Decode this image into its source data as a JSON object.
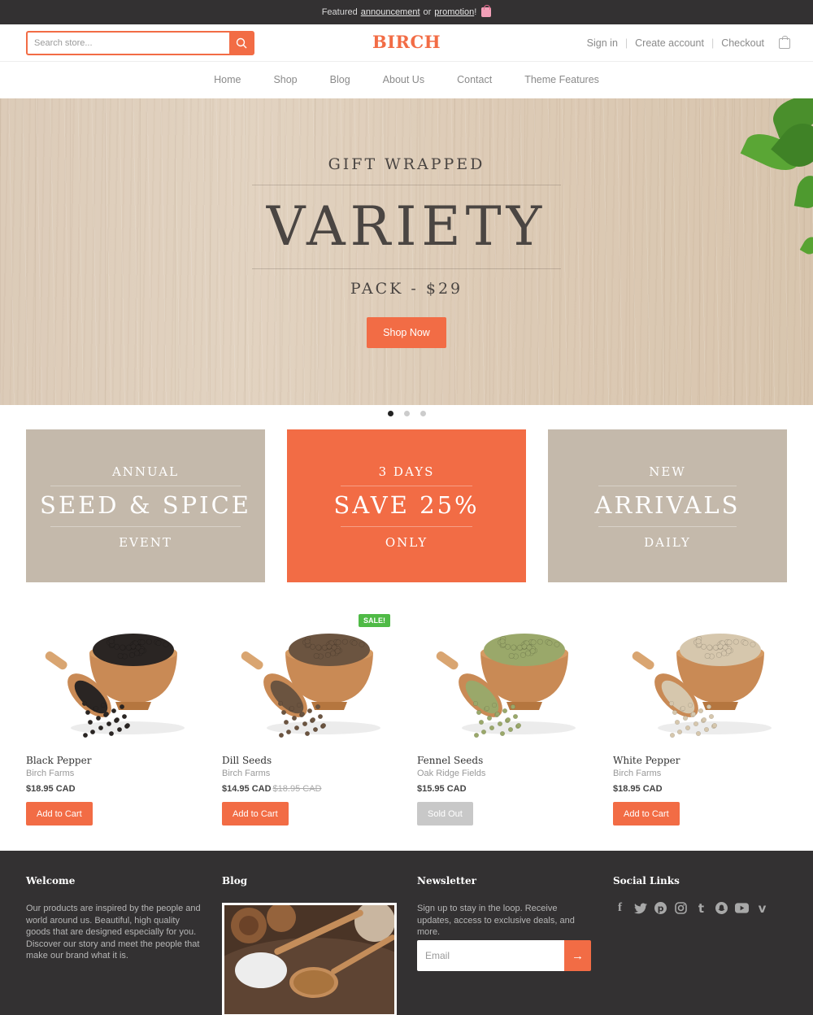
{
  "announcement": {
    "prefix": "Featured",
    "link1": "announcement",
    "middle": "or",
    "link2": "promotion",
    "suffix": "!"
  },
  "header": {
    "search_placeholder": "Search store...",
    "logo": "BIRCH",
    "account_links": [
      "Sign in",
      "Create account",
      "Checkout"
    ],
    "cart_icon": "shopping-bag-icon"
  },
  "nav": {
    "items": [
      "Home",
      "Shop",
      "Blog",
      "About Us",
      "Contact",
      "Theme Features"
    ]
  },
  "hero": {
    "kicker": "GIFT WRAPPED",
    "title": "VARIETY",
    "subtitle": "PACK - $29",
    "button": "Shop Now",
    "slides": 3,
    "active_slide": 1
  },
  "promos": [
    {
      "top": "ANNUAL",
      "main": "SEED & SPICE",
      "bottom": "EVENT",
      "color": "#c4b9ab"
    },
    {
      "top": "3 DAYS",
      "main": "SAVE 25%",
      "bottom": "ONLY",
      "color": "#f26c45"
    },
    {
      "top": "NEW",
      "main": "ARRIVALS",
      "bottom": "DAILY",
      "color": "#c4b9ab"
    }
  ],
  "products": [
    {
      "name": "Black Pepper",
      "vendor": "Birch Farms",
      "price": "$18.95 CAD",
      "old_price": "",
      "badge": "",
      "button": "Add to Cart",
      "seed_color": "#2a2523"
    },
    {
      "name": "Dill Seeds",
      "vendor": "Birch Farms",
      "price": "$14.95 CAD",
      "old_price": "$18.95 CAD",
      "badge": "SALE!",
      "button": "Add to Cart",
      "seed_color": "#6b5440"
    },
    {
      "name": "Fennel Seeds",
      "vendor": "Oak Ridge Fields",
      "price": "$15.95 CAD",
      "old_price": "",
      "badge": "",
      "button": "Sold Out",
      "seed_color": "#9aa86a"
    },
    {
      "name": "White Pepper",
      "vendor": "Birch Farms",
      "price": "$18.95 CAD",
      "old_price": "",
      "badge": "",
      "button": "Add to Cart",
      "seed_color": "#d6c7ad"
    }
  ],
  "footer": {
    "welcome_title": "Welcome",
    "welcome_text": "Our products are inspired by the people and world around us. Beautiful, high quality goods that are designed especially for you. Discover our story and meet the people that make our brand what it is.",
    "blog_title": "Blog",
    "newsletter_title": "Newsletter",
    "newsletter_text": "Sign up to stay in the loop. Receive updates, access to exclusive deals, and more.",
    "email_placeholder": "Email",
    "social_title": "Social Links",
    "social_icons": [
      "facebook-icon",
      "twitter-icon",
      "pinterest-icon",
      "instagram-icon",
      "tumblr-icon",
      "snapchat-icon",
      "youtube-icon",
      "vimeo-icon"
    ]
  },
  "colors": {
    "accent": "#f26c45",
    "dark": "#333132",
    "tan": "#c4b9ab",
    "sale": "#4fba46"
  }
}
